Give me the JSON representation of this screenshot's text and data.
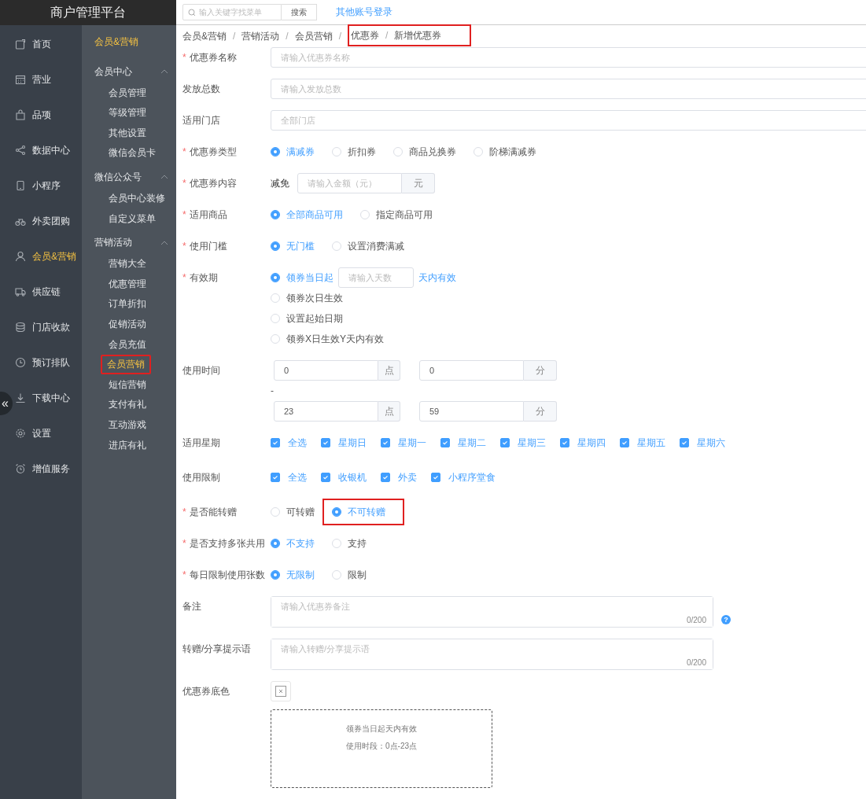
{
  "app_title": "商户管理平台",
  "topbar": {
    "search": {
      "placeholder": "输入关键字找菜单"
    },
    "search_button": "搜索",
    "link": "其他账号登录"
  },
  "collapse_button": "«",
  "nav": [
    {
      "label": "首页",
      "selected": false
    },
    {
      "label": "营业",
      "selected": false
    },
    {
      "label": "品项",
      "selected": false
    },
    {
      "label": "数据中心",
      "selected": false
    },
    {
      "label": "小程序",
      "selected": false
    },
    {
      "label": "外卖团购",
      "selected": false
    },
    {
      "label": "会员&营销",
      "selected": true
    },
    {
      "label": "供应链",
      "selected": false
    },
    {
      "label": "门店收款",
      "selected": false
    },
    {
      "label": "预订排队",
      "selected": false
    },
    {
      "label": "下载中心",
      "selected": false
    },
    {
      "label": "设置",
      "selected": false
    },
    {
      "label": "增值服务",
      "selected": false
    }
  ],
  "subnav": {
    "title": "会员&营销",
    "groups": [
      {
        "title": "会员中心",
        "expanded": true,
        "items": [
          {
            "label": "会员管理",
            "selected": false,
            "highlighted": false
          },
          {
            "label": "等级管理",
            "selected": false,
            "highlighted": false
          },
          {
            "label": "其他设置",
            "selected": false,
            "highlighted": false
          },
          {
            "label": "微信会员卡",
            "selected": false,
            "highlighted": false
          }
        ]
      },
      {
        "title": "微信公众号",
        "expanded": true,
        "items": [
          {
            "label": "会员中心装修",
            "selected": false,
            "highlighted": false
          },
          {
            "label": "自定义菜单",
            "selected": false,
            "highlighted": false
          }
        ]
      },
      {
        "title": "营销活动",
        "expanded": true,
        "items": [
          {
            "label": "营销大全",
            "selected": false,
            "highlighted": false
          },
          {
            "label": "优惠管理",
            "selected": false,
            "highlighted": false
          },
          {
            "label": "订单折扣",
            "selected": false,
            "highlighted": false
          },
          {
            "label": "促销活动",
            "selected": false,
            "highlighted": false
          },
          {
            "label": "会员充值",
            "selected": false,
            "highlighted": false
          },
          {
            "label": "会员营销",
            "selected": true,
            "highlighted": true
          },
          {
            "label": "短信营销",
            "selected": false,
            "highlighted": false
          },
          {
            "label": "支付有礼",
            "selected": false,
            "highlighted": false
          },
          {
            "label": "互动游戏",
            "selected": false,
            "highlighted": false
          },
          {
            "label": "进店有礼",
            "selected": false,
            "highlighted": false
          }
        ]
      }
    ]
  },
  "breadcrumb": {
    "separator": "/",
    "items": [
      {
        "label": "会员&营销",
        "highlighted": false
      },
      {
        "label": "营销活动",
        "highlighted": false
      },
      {
        "label": "会员营销",
        "highlighted": false
      },
      {
        "label": "优惠券",
        "highlighted": true
      },
      {
        "label": "新增优惠券",
        "highlighted": true
      }
    ]
  },
  "form": [
    {
      "kind": "text",
      "label": "优惠券名称",
      "required_mark": "*",
      "placeholder": "请输入优惠券名称"
    },
    {
      "kind": "text",
      "label": "发放总数",
      "placeholder": "请输入发放总数"
    },
    {
      "kind": "text",
      "label": "适用门店",
      "placeholder": "全部门店"
    },
    {
      "kind": "radio",
      "label": "优惠券类型",
      "required_mark": "*",
      "options": [
        {
          "label": "满减券",
          "selected": true,
          "highlighted": false
        },
        {
          "label": "折扣券",
          "selected": false,
          "highlighted": false
        },
        {
          "label": "商品兑换券",
          "selected": false,
          "highlighted": false
        },
        {
          "label": "阶梯满减券",
          "selected": false,
          "highlighted": false
        }
      ]
    },
    {
      "kind": "amount",
      "label": "优惠券内容",
      "required_mark": "*",
      "prefix": "减免",
      "placeholder": "请输入金额（元）",
      "suffix": "元"
    },
    {
      "kind": "radio",
      "label": "适用商品",
      "required_mark": "*",
      "options": [
        {
          "label": "全部商品可用",
          "selected": true,
          "highlighted": false
        },
        {
          "label": "指定商品可用",
          "selected": false,
          "highlighted": false
        }
      ]
    },
    {
      "kind": "radio",
      "label": "使用门槛",
      "required_mark": "*",
      "options": [
        {
          "label": "无门槛",
          "selected": true,
          "highlighted": false
        },
        {
          "label": "设置消费满减",
          "selected": false,
          "highlighted": false
        }
      ]
    },
    {
      "kind": "validity",
      "label": "有效期",
      "required_mark": "*",
      "options": [
        {
          "label": "领券当日起",
          "selected": true,
          "placeholder": "请输入天数",
          "suffix": "天内有效"
        },
        {
          "label": "领券次日生效",
          "selected": false
        },
        {
          "label": "设置起始日期",
          "selected": false
        },
        {
          "label": "领券X日生效Y天内有效",
          "selected": false
        }
      ]
    },
    {
      "kind": "time",
      "label": "使用时间",
      "separator": "-",
      "ranges": [
        {
          "hour": "0",
          "hour_unit": "点",
          "minute": "0",
          "minute_unit": "分"
        },
        {
          "hour": "23",
          "hour_unit": "点",
          "minute": "59",
          "minute_unit": "分"
        }
      ]
    },
    {
      "kind": "checkbox",
      "label": "适用星期",
      "options": [
        {
          "label": "全选",
          "checked": true
        },
        {
          "label": "星期日",
          "checked": true
        },
        {
          "label": "星期一",
          "checked": true
        },
        {
          "label": "星期二",
          "checked": true
        },
        {
          "label": "星期三",
          "checked": true
        },
        {
          "label": "星期四",
          "checked": true
        },
        {
          "label": "星期五",
          "checked": true
        },
        {
          "label": "星期六",
          "checked": true
        }
      ]
    },
    {
      "kind": "checkbox",
      "label": "使用限制",
      "options": [
        {
          "label": "全选",
          "checked": true
        },
        {
          "label": "收银机",
          "checked": true
        },
        {
          "label": "外卖",
          "checked": true
        },
        {
          "label": "小程序堂食",
          "checked": true
        }
      ]
    },
    {
      "kind": "radio",
      "label": "是否能转赠",
      "required_mark": "*",
      "options": [
        {
          "label": "可转赠",
          "selected": false,
          "highlighted": false
        },
        {
          "label": "不可转赠",
          "selected": true,
          "highlighted": true
        }
      ]
    },
    {
      "kind": "radio",
      "label": "是否支持多张共用",
      "required_mark": "*",
      "options": [
        {
          "label": "不支持",
          "selected": true,
          "highlighted": false
        },
        {
          "label": "支持",
          "selected": false,
          "highlighted": false
        }
      ]
    },
    {
      "kind": "radio",
      "label": "每日限制使用张数",
      "required_mark": "*",
      "options": [
        {
          "label": "无限制",
          "selected": true,
          "highlighted": false
        },
        {
          "label": "限制",
          "selected": false,
          "highlighted": false
        }
      ]
    },
    {
      "kind": "textarea",
      "label": "备注",
      "placeholder": "请输入优惠券备注",
      "counter": "0/200",
      "help": "?"
    },
    {
      "kind": "textarea",
      "label": "转赠/分享提示语",
      "placeholder": "请输入转赠/分享提示语",
      "counter": "0/200"
    },
    {
      "kind": "color",
      "label": "优惠券底色",
      "preview": [
        "领券当日起天内有效",
        "使用时段：0点-23点"
      ]
    }
  ]
}
